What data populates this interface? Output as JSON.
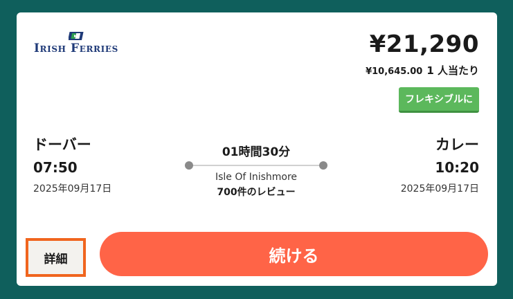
{
  "operator": {
    "name": "Irish Ferries",
    "logo_icon": "irish-ferries-flag-icon",
    "brand_color": "#1f3a78"
  },
  "pricing": {
    "total": "¥21,290",
    "per_person_amount": "¥10,645.00",
    "per_person_label": "1 人当たり",
    "flex_badge": "フレキシブルに",
    "badge_color": "#5cb85c"
  },
  "departure": {
    "city": "ドーバー",
    "time": "07:50",
    "date": "2025年09月17日"
  },
  "arrival": {
    "city": "カレー",
    "time": "10:20",
    "date": "2025年09月17日"
  },
  "route": {
    "duration": "01時間30分",
    "ship": "Isle Of Inishmore",
    "reviews": "700件のレビュー"
  },
  "actions": {
    "details_label": "詳細",
    "continue_label": "続ける",
    "continue_color": "#ff6447",
    "details_focus_color": "#f0651e"
  },
  "colors": {
    "page_background": "#0f5f5c",
    "card_background": "#ffffff"
  }
}
